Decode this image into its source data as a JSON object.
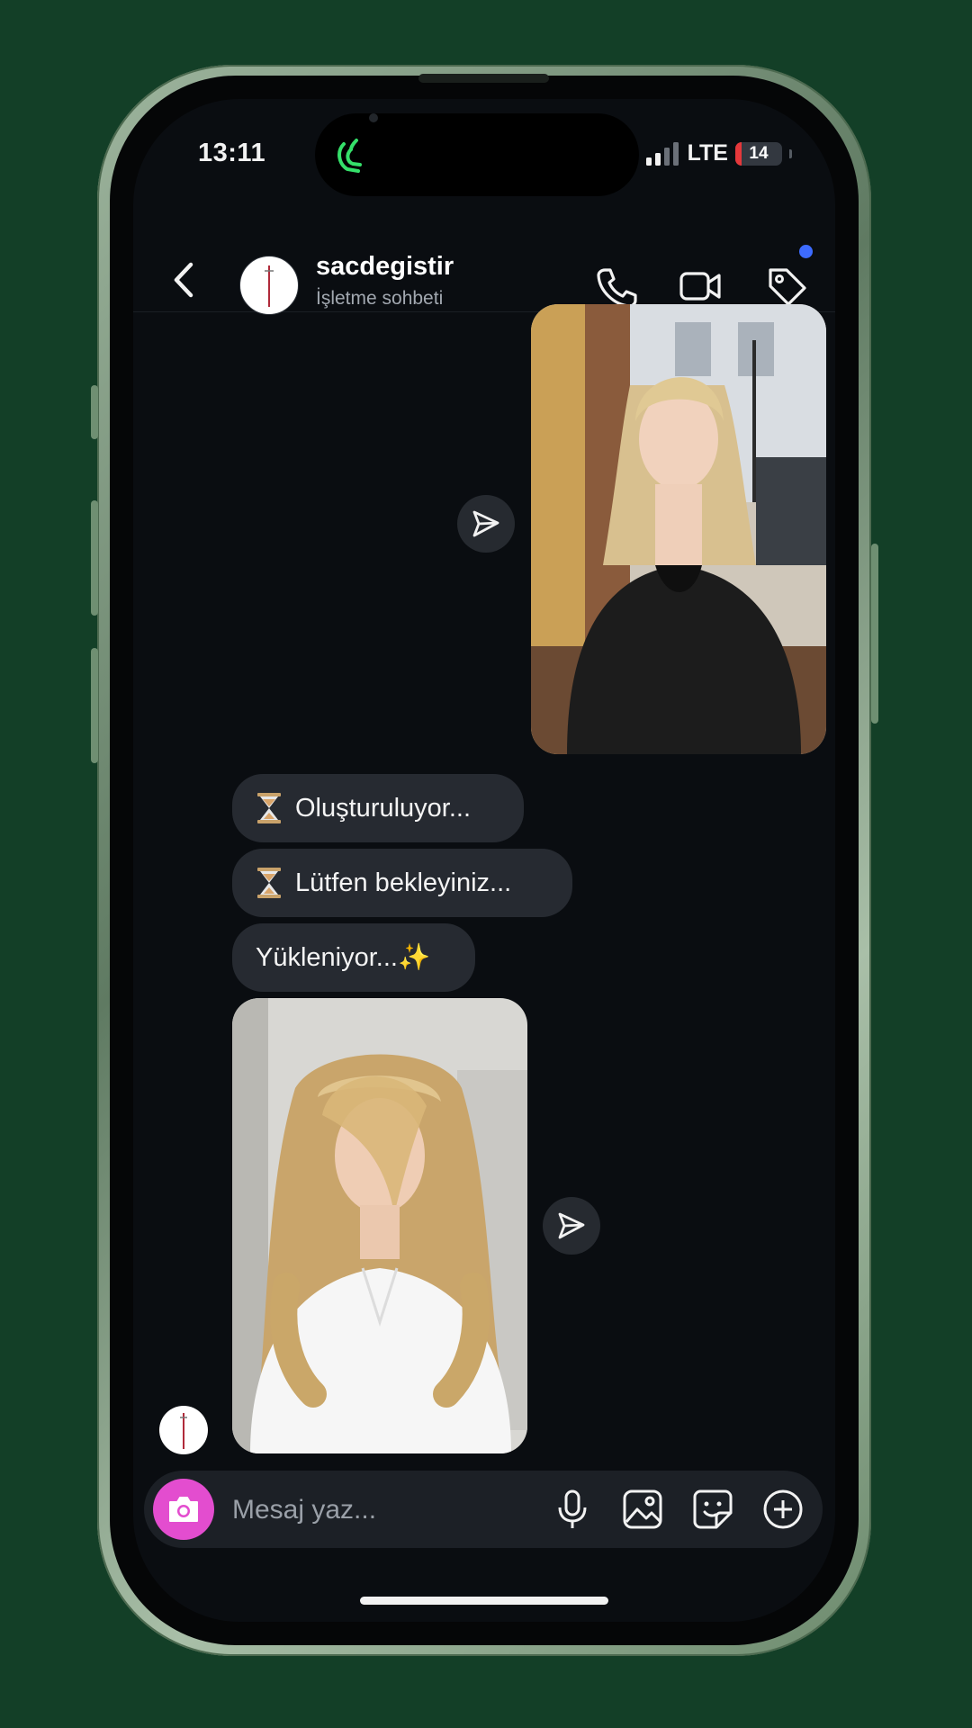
{
  "status_bar": {
    "time": "13:11",
    "network": "LTE",
    "battery_level": "14",
    "battery_fraction": 0.14
  },
  "header": {
    "contact_name": "sacdegistir",
    "contact_subtitle": "İşletme sohbeti",
    "icons": [
      "back-chevron-icon",
      "phone-icon",
      "video-camera-icon",
      "tag-icon"
    ],
    "notification_dot_color": "#3d6bff"
  },
  "messages": [
    {
      "type": "image",
      "direction": "outgoing",
      "description_icon": "photo"
    },
    {
      "type": "text",
      "direction": "incoming",
      "emoji": "⏳",
      "text": "Oluşturuluyor..."
    },
    {
      "type": "text",
      "direction": "incoming",
      "emoji": "⏳",
      "text": "Lütfen bekleyiniz..."
    },
    {
      "type": "text",
      "direction": "incoming",
      "text": "Yükleniyor...✨"
    },
    {
      "type": "image",
      "direction": "incoming",
      "description_icon": "photo"
    }
  ],
  "composer": {
    "placeholder": "Mesaj yaz...",
    "camera_color": "#e34dcf",
    "icons": [
      "camera-icon",
      "microphone-icon",
      "gallery-icon",
      "sticker-icon",
      "plus-circle-icon"
    ]
  },
  "colors": {
    "background": "#133f27",
    "screen": "#0a0d11",
    "bubble": "#262a31"
  }
}
